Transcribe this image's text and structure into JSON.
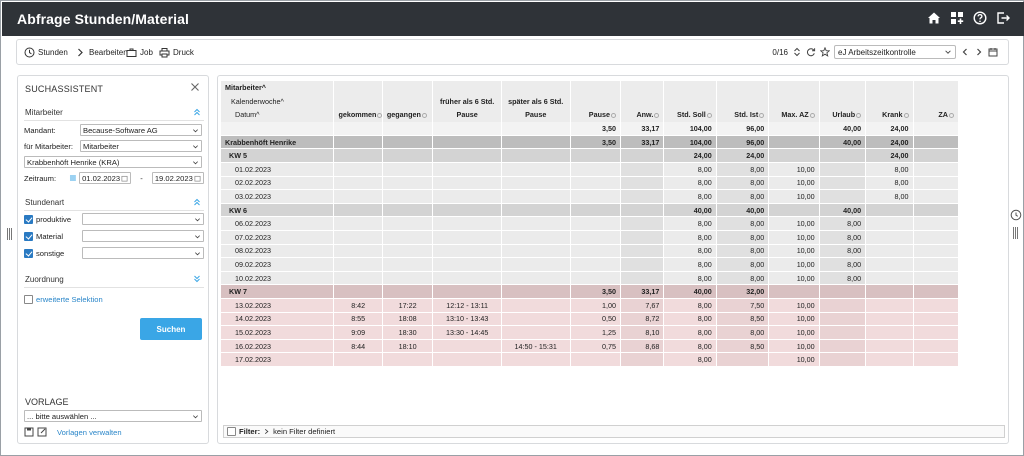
{
  "app": {
    "title": "Abfrage Stunden/Material"
  },
  "toolbar": {
    "stunden": "Stunden",
    "bearbeiten": "Bearbeiten",
    "job": "Job",
    "druck": "Druck",
    "counter": "0/16",
    "view": "eJ Arbeitszeitkontrolle"
  },
  "search": {
    "title": "SUCHASSISTENT",
    "mitarbeiter_section": "Mitarbeiter",
    "mandant_label": "Mandant:",
    "mandant_value": "Because-Software AG",
    "fuer_label": "für Mitarbeiter:",
    "fuer_value": "Mitarbeiter",
    "person_value": "Krabbenhöft Henrike (KRA)",
    "zeitraum_label": "Zeitraum:",
    "date_from": "01.02.2023",
    "date_sep": "-",
    "date_to": "19.02.2023",
    "stundenart_section": "Stundenart",
    "art": [
      {
        "label": "produktive",
        "checked": true
      },
      {
        "label": "Material",
        "checked": true
      },
      {
        "label": "sonstige",
        "checked": true
      }
    ],
    "zuordnung_section": "Zuordnung",
    "erweitert_label": "erweiterte Selektion",
    "suchen_button": "Suchen",
    "vorlage_title": "VORLAGE",
    "vorlage_value": "... bitte auswählen ...",
    "vorlage_link": "Vorlagen verwalten"
  },
  "grid": {
    "group1": "Mitarbeiter^",
    "group2": "Kalenderwoche^",
    "group3": "Datum^",
    "early_head": "früher als 6 Std.",
    "late_head": "später als 6 Std.",
    "columns": [
      "gekommen",
      "gegangen",
      "Pause",
      "Pause",
      "Pause",
      "Anw.",
      "Std. Soll",
      "Std. Ist",
      "Max. AZ",
      "Urlaub",
      "Krank",
      "ZA"
    ],
    "total": {
      "pause": "3,50",
      "anw": "33,17",
      "soll": "104,00",
      "ist": "96,00",
      "urlaub": "40,00",
      "krank": "24,00"
    },
    "rows": [
      {
        "kind": "emp",
        "label": "Krabbenhöft Henrike",
        "pause": "3,50",
        "anw": "33,17",
        "soll": "104,00",
        "ist": "96,00",
        "urlaub": "40,00",
        "krank": "24,00"
      },
      {
        "kind": "wk",
        "label": "KW 5",
        "soll": "24,00",
        "ist": "24,00",
        "krank": "24,00"
      },
      {
        "kind": "day",
        "label": "01.02.2023",
        "soll": "8,00",
        "ist": "8,00",
        "maxaz": "10,00",
        "krank": "8,00"
      },
      {
        "kind": "day",
        "label": "02.02.2023",
        "soll": "8,00",
        "ist": "8,00",
        "maxaz": "10,00",
        "krank": "8,00"
      },
      {
        "kind": "day",
        "label": "03.02.2023",
        "soll": "8,00",
        "ist": "8,00",
        "maxaz": "10,00",
        "krank": "8,00"
      },
      {
        "kind": "wk",
        "label": "KW 6",
        "soll": "40,00",
        "ist": "40,00",
        "urlaub": "40,00"
      },
      {
        "kind": "day",
        "label": "06.02.2023",
        "soll": "8,00",
        "ist": "8,00",
        "maxaz": "10,00",
        "urlaub": "8,00"
      },
      {
        "kind": "day",
        "label": "07.02.2023",
        "soll": "8,00",
        "ist": "8,00",
        "maxaz": "10,00",
        "urlaub": "8,00"
      },
      {
        "kind": "day",
        "label": "08.02.2023",
        "soll": "8,00",
        "ist": "8,00",
        "maxaz": "10,00",
        "urlaub": "8,00"
      },
      {
        "kind": "day",
        "label": "09.02.2023",
        "soll": "8,00",
        "ist": "8,00",
        "maxaz": "10,00",
        "urlaub": "8,00"
      },
      {
        "kind": "day",
        "label": "10.02.2023",
        "soll": "8,00",
        "ist": "8,00",
        "maxaz": "10,00",
        "urlaub": "8,00"
      },
      {
        "kind": "wkhi",
        "label": "KW 7",
        "pause": "3,50",
        "anw": "33,17",
        "soll": "40,00",
        "ist": "32,00"
      },
      {
        "kind": "hi",
        "label": "13.02.2023",
        "kommen": "8:42",
        "gehen": "17:22",
        "early": "12:12  -  13:11",
        "pause": "1,00",
        "anw": "7,67",
        "soll": "8,00",
        "ist": "7,50",
        "maxaz": "10,00"
      },
      {
        "kind": "hi",
        "label": "14.02.2023",
        "kommen": "8:55",
        "gehen": "18:08",
        "early": "13:10  -  13:43",
        "pause": "0,50",
        "anw": "8,72",
        "soll": "8,00",
        "ist": "8,50",
        "maxaz": "10,00"
      },
      {
        "kind": "hi",
        "label": "15.02.2023",
        "kommen": "9:09",
        "gehen": "18:30",
        "early": "13:30  -  14:45",
        "pause": "1,25",
        "anw": "8,10",
        "soll": "8,00",
        "ist": "8,00",
        "maxaz": "10,00"
      },
      {
        "kind": "hi",
        "label": "16.02.2023",
        "kommen": "8:44",
        "gehen": "18:10",
        "late": "14:50  -  15:31",
        "pause": "0,75",
        "anw": "8,68",
        "soll": "8,00",
        "ist": "8,50",
        "maxaz": "10,00"
      },
      {
        "kind": "hi",
        "label": "17.02.2023",
        "soll": "8,00",
        "maxaz": "10,00"
      }
    ]
  },
  "filter": {
    "label": "Filter:",
    "value": "kein Filter definiert"
  },
  "colors": {
    "titlebar": "#2f3338",
    "accent": "#3aa6e6",
    "highlight": "#f1dbdc"
  }
}
